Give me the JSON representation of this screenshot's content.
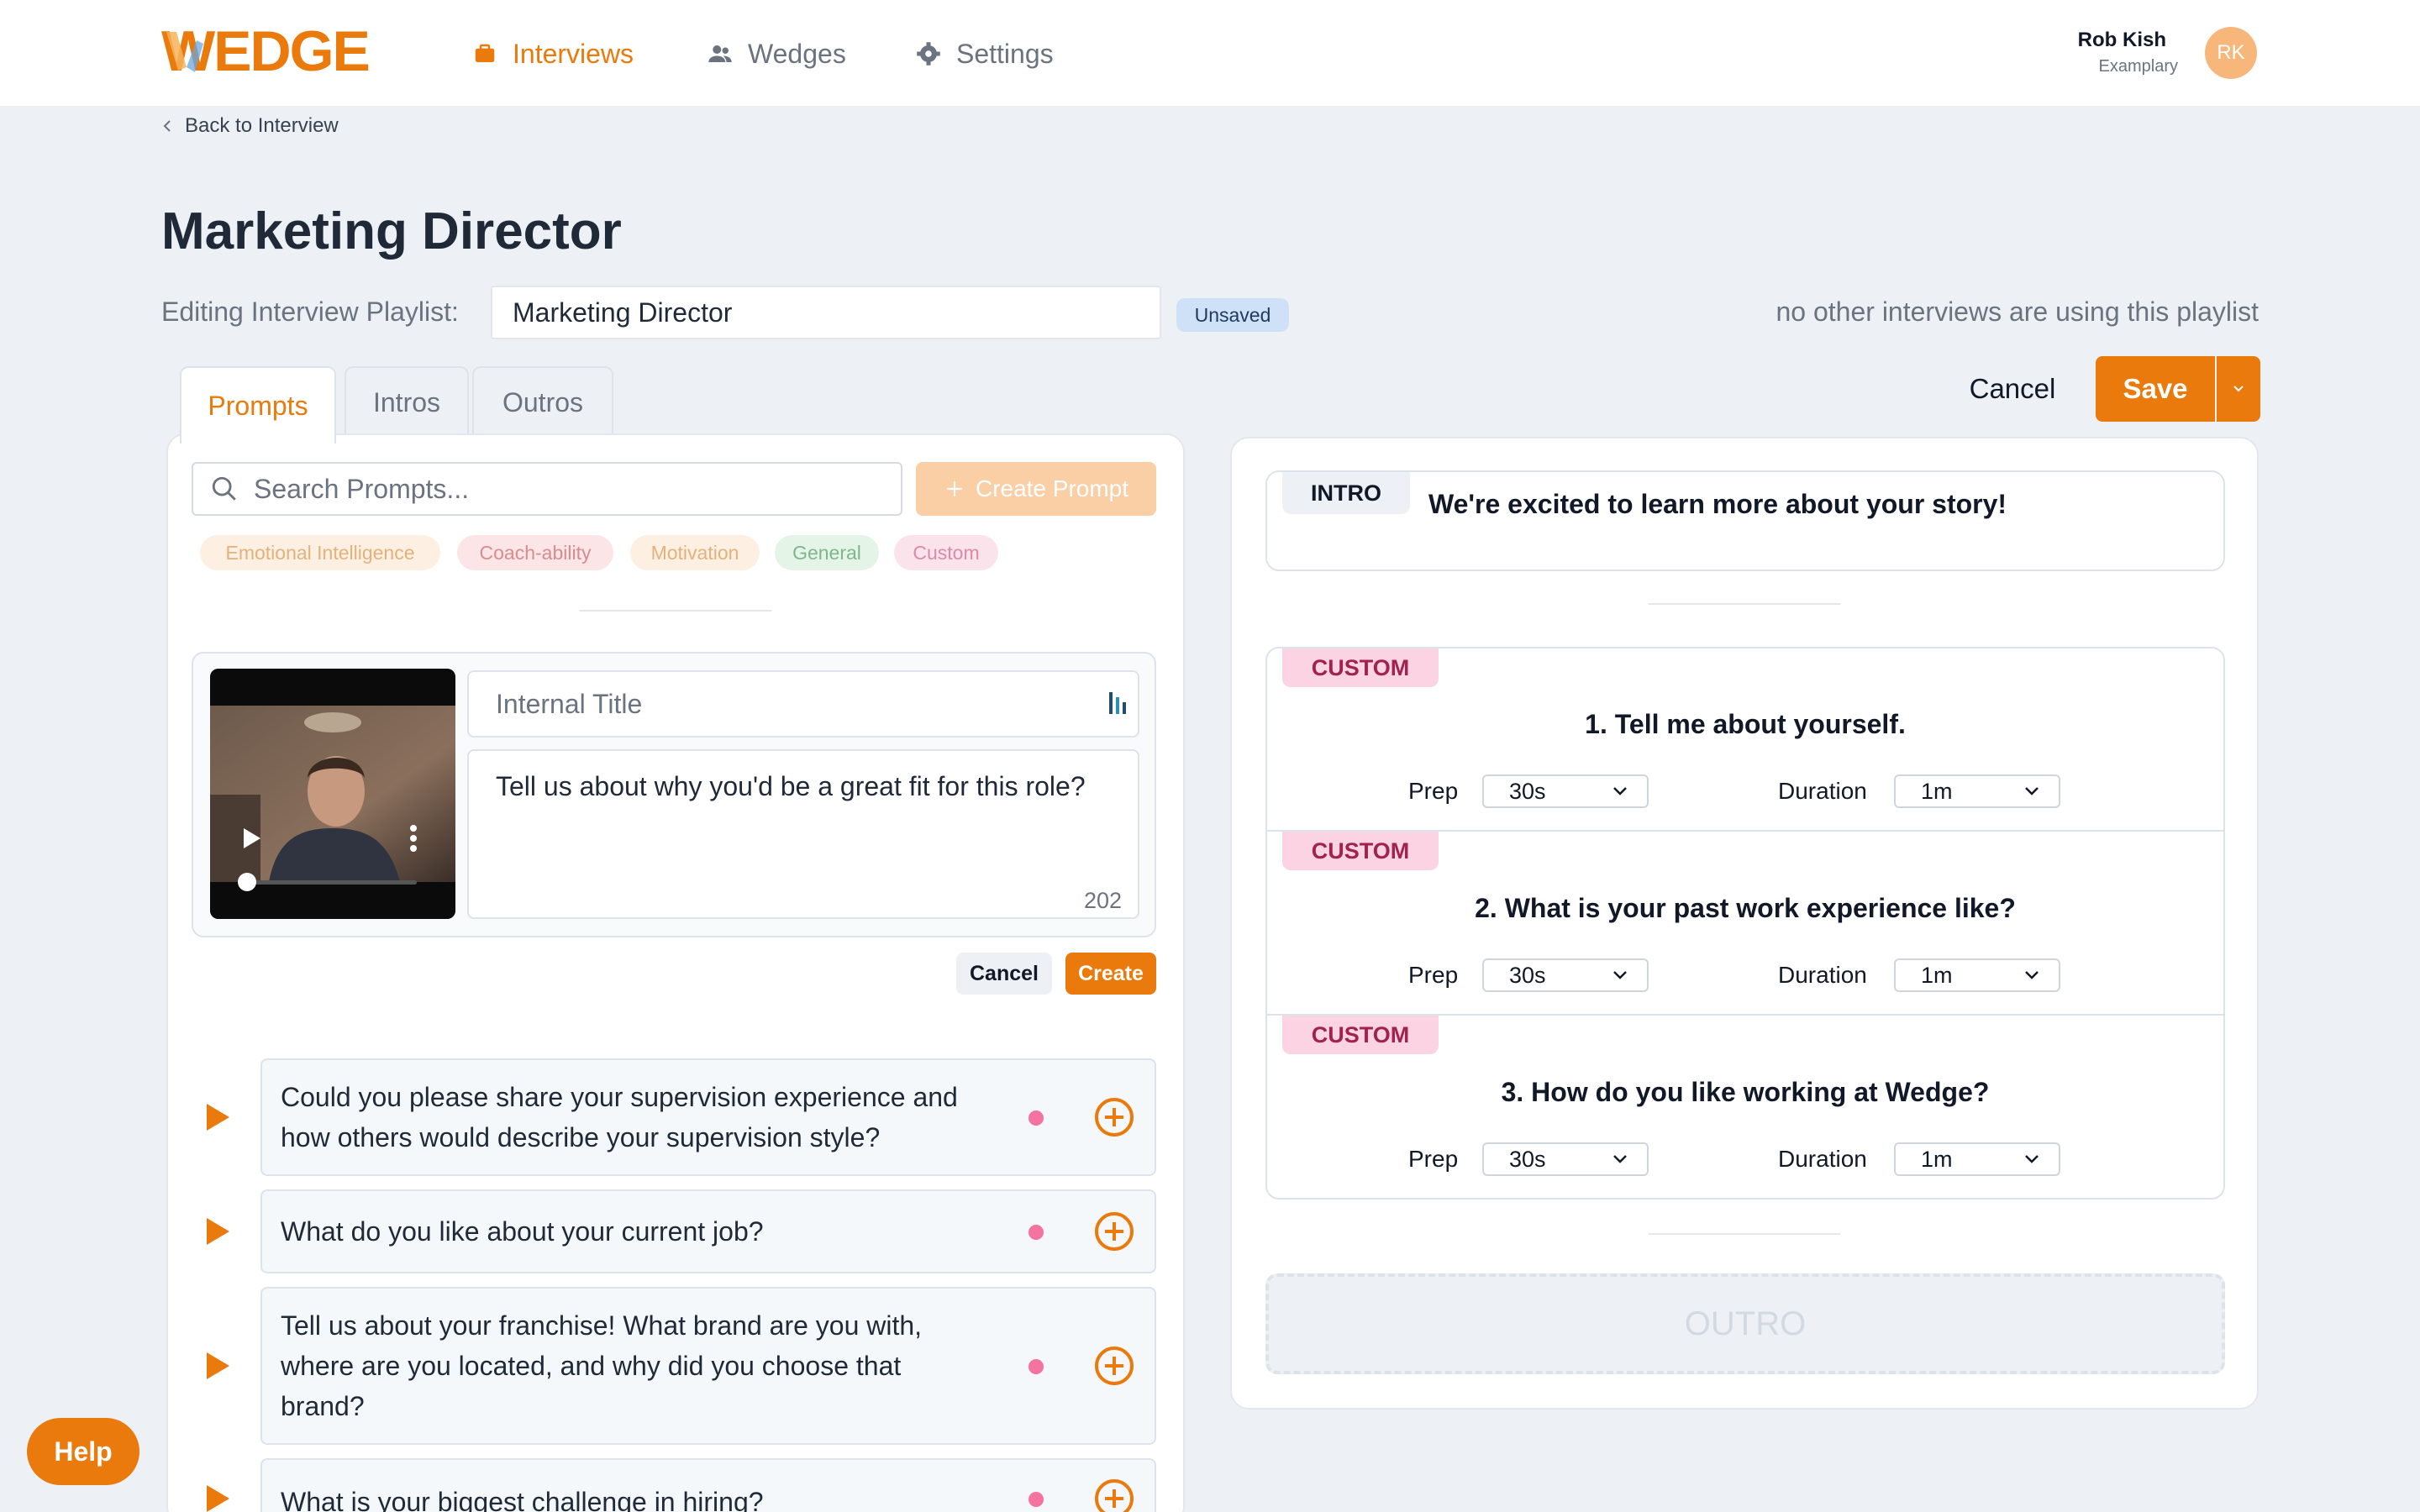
{
  "brand": {
    "logo_text": "WEDGE",
    "accent": "#ea7a0c"
  },
  "nav": {
    "items": [
      {
        "label": "Interviews",
        "icon": "briefcase-icon",
        "active": true
      },
      {
        "label": "Wedges",
        "icon": "users-icon",
        "active": false
      },
      {
        "label": "Settings",
        "icon": "gear-icon",
        "active": false
      }
    ]
  },
  "user": {
    "name": "Rob Kish",
    "org": "Examplary",
    "initials": "RK"
  },
  "back_link": "Back to Interview",
  "page": {
    "title": "Marketing Director",
    "editing_label": "Editing Interview Playlist:",
    "playlist_name": "Marketing Director",
    "status_badge": "Unsaved",
    "usage_note": "no other interviews are using this playlist"
  },
  "tabs": [
    {
      "label": "Prompts",
      "active": true
    },
    {
      "label": "Intros",
      "active": false
    },
    {
      "label": "Outros",
      "active": false
    }
  ],
  "actions": {
    "cancel": "Cancel",
    "save": "Save"
  },
  "prompts_panel": {
    "search_placeholder": "Search Prompts...",
    "create_prompt_label": "Create Prompt",
    "tags": [
      {
        "label": "Emotional Intelligence",
        "bg": "#fdf0e2",
        "fg": "#e3b27c"
      },
      {
        "label": "Coach-ability",
        "bg": "#fbe5e6",
        "fg": "#d88c92"
      },
      {
        "label": "Motivation",
        "bg": "#fdf0e2",
        "fg": "#e3b27c"
      },
      {
        "label": "General",
        "bg": "#e4f5e8",
        "fg": "#7fb68e"
      },
      {
        "label": "Custom",
        "bg": "#fbe3ec",
        "fg": "#dd8aa8"
      }
    ],
    "new_prompt": {
      "title_placeholder": "Internal Title",
      "text": "Tell us about why you'd be a great fit for this role?",
      "char_count": "202",
      "cancel_label": "Cancel",
      "create_label": "Create"
    },
    "library": [
      {
        "text": "Could you please share your supervision experience and how others would describe your supervision style?"
      },
      {
        "text": "What do you like about your current job?"
      },
      {
        "text": "Tell us about your franchise! What brand are you with, where are you located, and why did you choose that brand?"
      },
      {
        "text": "What is your biggest challenge in hiring?"
      }
    ]
  },
  "playlist": {
    "intro": {
      "badge": "INTRO",
      "text": "We're excited to learn more about your story!"
    },
    "prep_label": "Prep",
    "duration_label": "Duration",
    "questions": [
      {
        "badge": "CUSTOM",
        "title": "1. Tell me about yourself.",
        "prep": "30s",
        "duration": "1m"
      },
      {
        "badge": "CUSTOM",
        "title": "2. What is your past work experience like?",
        "prep": "30s",
        "duration": "1m"
      },
      {
        "badge": "CUSTOM",
        "title": "3. How do you like working at Wedge?",
        "prep": "30s",
        "duration": "1m"
      }
    ],
    "outro_placeholder": "OUTRO"
  },
  "help_label": "Help"
}
